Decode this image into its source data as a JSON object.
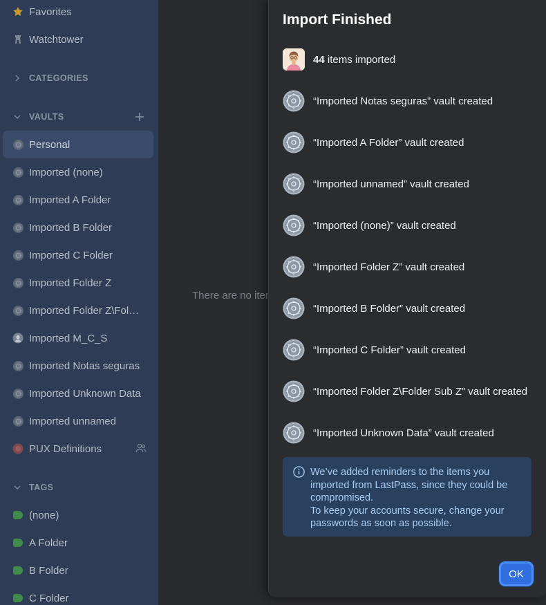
{
  "sidebar": {
    "favorites_label": "Favorites",
    "watchtower_label": "Watchtower",
    "categories_header": "CATEGORIES",
    "vaults_header": "VAULTS",
    "vaults": [
      "Personal",
      "Imported (none)",
      "Imported A Folder",
      "Imported B Folder",
      "Imported C Folder",
      "Imported Folder Z",
      "Imported Folder Z\\Fold...",
      "Imported M_C_S",
      "Imported Notas seguras",
      "Imported Unknown Data",
      "Imported unnamed",
      "PUX Definitions"
    ],
    "tags_header": "TAGS",
    "tags": [
      "(none)",
      "A Folder",
      "B Folder",
      "C Folder"
    ]
  },
  "main": {
    "empty_text": "There are no items"
  },
  "dialog": {
    "title": "Import Finished",
    "items_count": "44",
    "items_suffix": " items imported",
    "vault_results": [
      "“Imported Notas seguras” vault created",
      "“Imported A Folder” vault created",
      "“Imported unnamed” vault created",
      "“Imported (none)” vault created",
      "“Imported Folder Z” vault created",
      "“Imported B Folder” vault created",
      "“Imported C Folder” vault created",
      "“Imported Folder Z\\Folder Sub Z” vault created",
      "“Imported Unknown Data” vault created"
    ],
    "notice_line1": "We’ve added reminders to the items you imported from LastPass, since they could be compromised.",
    "notice_line2": "To keep your accounts secure, change your passwords as soon as possible.",
    "ok_label": "OK"
  },
  "colors": {
    "sidebar_bg": "#2e3d55",
    "dialog_bg": "#2b2c2f",
    "notice_bg": "#29415f",
    "accent": "#2f6fe0",
    "tag_green": "#3f8a4c",
    "star_gold": "#c99a2e"
  }
}
